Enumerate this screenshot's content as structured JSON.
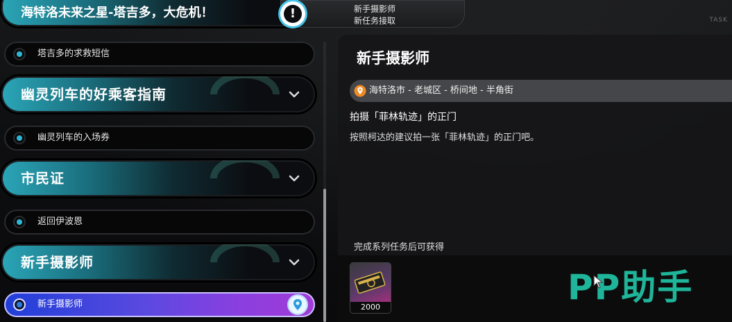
{
  "top_notice": {
    "line1": "新手摄影师",
    "line2": "新任务接取"
  },
  "brand_mark": "TASK",
  "categories": [
    {
      "title": "海特洛未来之星-塔吉多，大危机！",
      "quest": "塔吉多的求救短信"
    },
    {
      "title": "幽灵列车的好乘客指南",
      "quest": "幽灵列车的入场券"
    },
    {
      "title": "市民证",
      "quest": "返回伊波恩"
    },
    {
      "title": "新手摄影师",
      "quest": "新手摄影师"
    }
  ],
  "detail": {
    "title": "新手摄影师",
    "location": "海特洛市 - 老城区 - 桥间地 - 半角街",
    "objective": "拍摄「菲林轨迹」的正门",
    "description": "按照柯达的建议拍一张「菲林轨迹」的正门吧。",
    "reward_label": "完成系列任务后可获得",
    "reward_count": "2000"
  },
  "watermark": "PP助手",
  "colors": {
    "accent_teal": "#2aa6b8",
    "active_purple": "#8a3fe0",
    "location_pin": "#f08a24",
    "watermark_green": "#1fb59a"
  }
}
